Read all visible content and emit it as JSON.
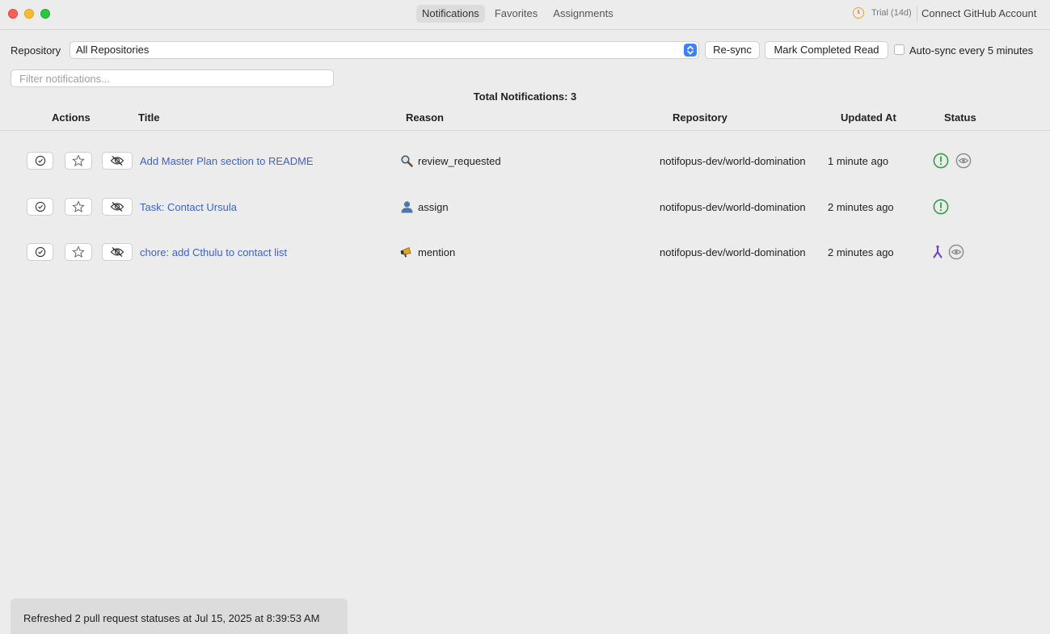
{
  "window": {
    "tabs": [
      {
        "label": "Notifications",
        "active": true
      },
      {
        "label": "Favorites",
        "active": false
      },
      {
        "label": "Assignments",
        "active": false
      }
    ],
    "trial_icon": "clock-icon",
    "trial_label": "Trial (14d)",
    "connect_label": "Connect GitHub Account"
  },
  "toolbar": {
    "repository_label": "Repository",
    "repository_value": "All Repositories",
    "resync_label": "Re-sync",
    "mark_read_label": "Mark Completed Read",
    "autosync_label": "Auto-sync every 5 minutes",
    "autosync_checked": false
  },
  "filter": {
    "placeholder": "Filter notifications..."
  },
  "summary": {
    "total_text": "Total Notifications: 3"
  },
  "table": {
    "headers": {
      "actions": "Actions",
      "title": "Title",
      "reason": "Reason",
      "repository": "Repository",
      "updated": "Updated At",
      "status": "Status"
    },
    "rows": [
      {
        "title": "Add Master Plan section to README",
        "reason": "review_requested",
        "reason_icon": "magnifier-icon",
        "repository": "notifopus-dev/world-domination",
        "updated": "1 minute ago",
        "status_icons": [
          "open-issue-icon",
          "eye-icon"
        ]
      },
      {
        "title": "Task: Contact Ursula",
        "reason": "assign",
        "reason_icon": "person-icon",
        "repository": "notifopus-dev/world-domination",
        "updated": "2 minutes ago",
        "status_icons": [
          "open-issue-icon"
        ]
      },
      {
        "title": "chore: add Cthulu to contact list",
        "reason": "mention",
        "reason_icon": "megaphone-icon",
        "repository": "notifopus-dev/world-domination",
        "updated": "2 minutes ago",
        "status_icons": [
          "merged-icon",
          "eye-icon"
        ]
      }
    ]
  },
  "status_bar": {
    "text": "Refreshed 2 pull request statuses at Jul 15, 2025 at 8:39:53 AM"
  },
  "colors": {
    "link": "#3e63c9",
    "open_green": "#2ea043",
    "merged_purple": "#6f42c1",
    "accent_blue": "#3b82f6"
  }
}
